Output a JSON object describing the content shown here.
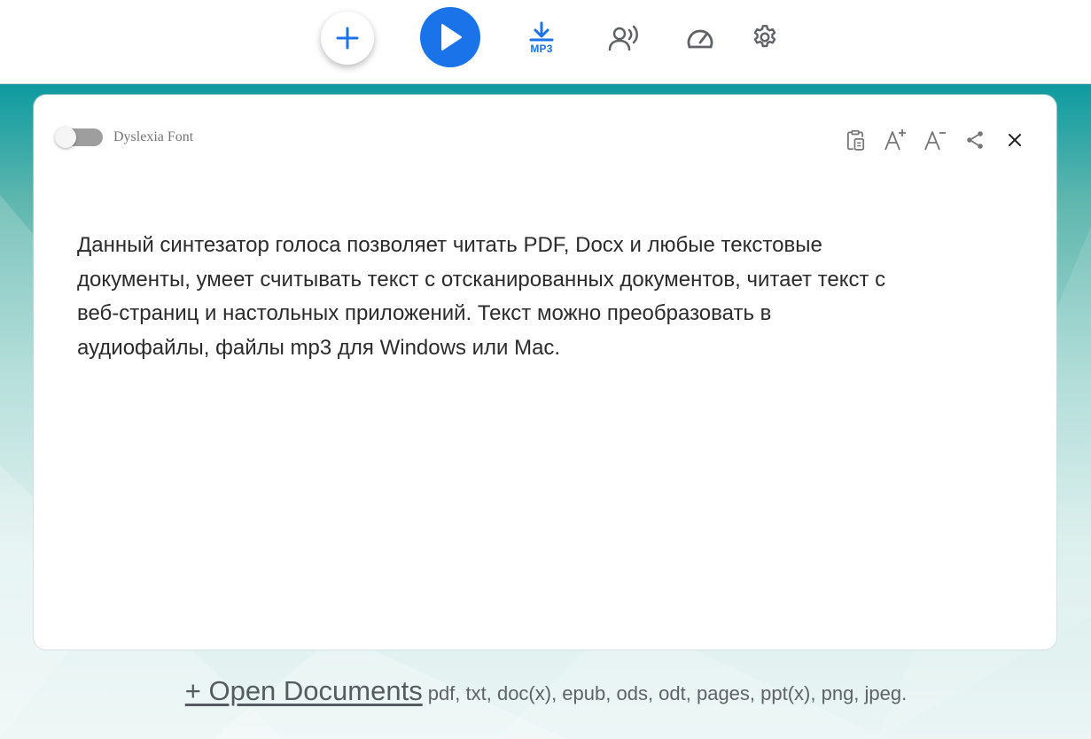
{
  "toolbar": {
    "mp3_label": "MP3",
    "accent_color": "#1a73e8",
    "icons": [
      "plus-icon",
      "play-icon",
      "download-mp3-icon",
      "voice-icon",
      "speedometer-icon",
      "gear-icon"
    ]
  },
  "card": {
    "toggle": {
      "label": "Dyslexia Font",
      "enabled": false
    },
    "icons": [
      "clipboard-icon",
      "font-increase-icon",
      "font-decrease-icon",
      "share-icon",
      "close-icon"
    ],
    "text": "Данный синтезатор голоса позволяет читать PDF, Docx и любые текстовые\nдокументы, умеет считывать текст с отсканированных документов, читает текст с\nвеб-страниц и настольных приложений. Текст можно преобразовать в\nаудиофайлы, файлы mp3 для Windows или Mac."
  },
  "footer": {
    "open_label": "+ Open Documents",
    "formats": "pdf, txt, doc(x), epub, ods, odt, pages, ppt(x), png, jpeg."
  },
  "colors": {
    "background_top": "#0e9aa0",
    "background_bottom": "#eaf5f4",
    "text": "#2b2b2b"
  }
}
